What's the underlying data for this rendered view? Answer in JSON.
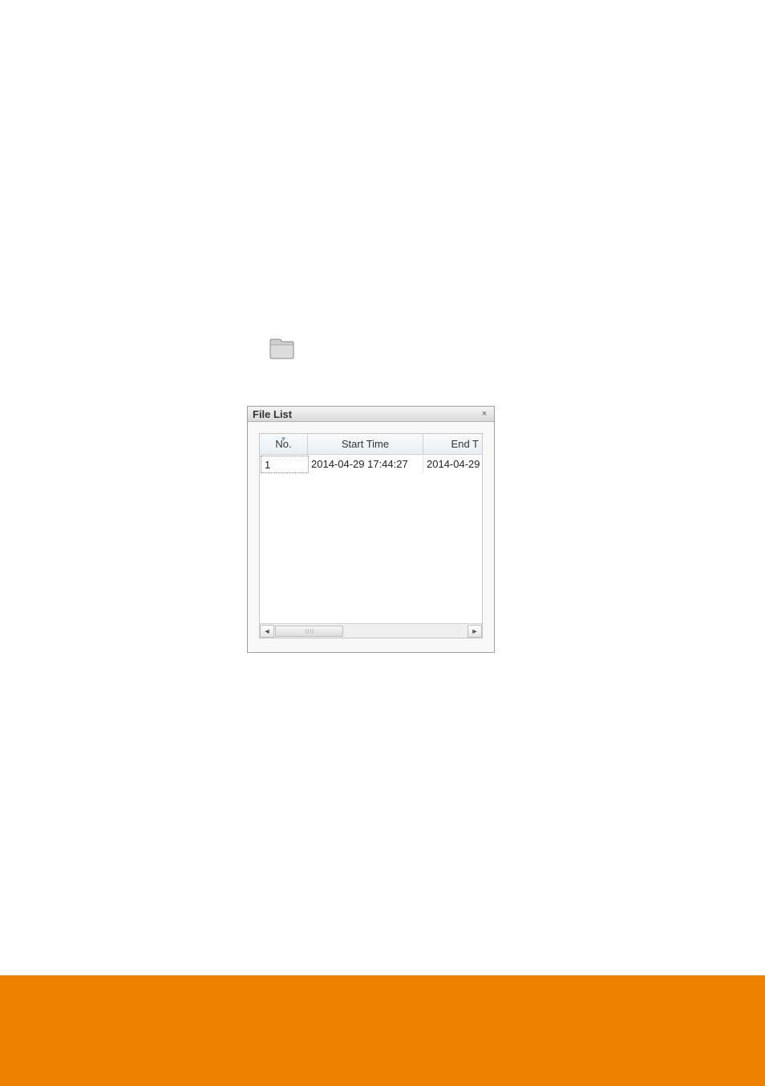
{
  "icons": {
    "folder": "folder-icon"
  },
  "file_list": {
    "title": "File List",
    "close_glyph": "×",
    "columns": {
      "no": "No.",
      "start": "Start Time",
      "end_truncated": "End T"
    },
    "scroll": {
      "left_glyph": "◄",
      "right_glyph": "►"
    },
    "rows": [
      {
        "no": "1",
        "start": "2014-04-29 17:44:27",
        "end_truncated": "2014-04-29"
      }
    ]
  },
  "colors": {
    "footer": "#ee8200"
  }
}
